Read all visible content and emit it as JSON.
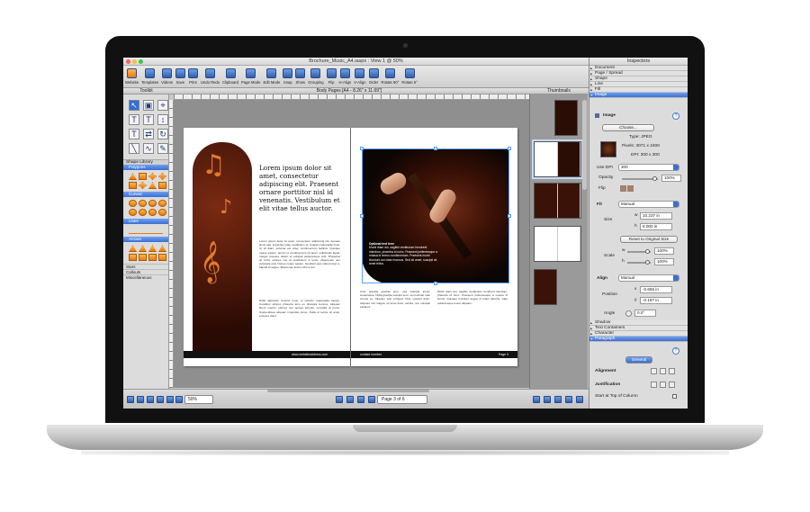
{
  "window": {
    "title": "Brochure_Music_A4.iaspx : View 1 @ 50%"
  },
  "toolbar": [
    {
      "label": "Website"
    },
    {
      "label": "Templates"
    },
    {
      "label": "Videos"
    },
    {
      "label": "Save"
    },
    {
      "label": "Print"
    },
    {
      "label": "Undo Redo"
    },
    {
      "label": "Clipboard"
    },
    {
      "label": "Page Mode"
    },
    {
      "label": "Edit Mode"
    },
    {
      "label": "Snap"
    },
    {
      "label": "Show"
    },
    {
      "label": "Grouping"
    },
    {
      "label": "Flip"
    },
    {
      "label": "H-Align"
    },
    {
      "label": "V-Align"
    },
    {
      "label": "Order"
    },
    {
      "label": "Rotate 90°"
    },
    {
      "label": "Rotate 5°"
    }
  ],
  "toolkit": {
    "title": "Toolkit",
    "shape_library": "Shape Library",
    "categories": {
      "polygons": "Polygons",
      "curved": "Curved",
      "lines": "Lines",
      "arrows": "Arrows",
      "stars": "Stars",
      "callouts": "Callouts",
      "misc": "Miscellaneous"
    }
  },
  "document": {
    "header": "Body Pages  [A4 - 8.26\" x 11.69\"]",
    "headline": "Lorem ipsum dolor sit amet, consectetur adipiscing elit. Praesent ornare porttitor nisl id venenatis. Vestibulum et elit vitae tellus auctor.",
    "body1": "Lorem ipsum dolor sit amet, consectetur adipiscing elit. Aenean lacus ulla, imperdiet vitae vestibulum et, feugiat malesuada risus. Ut sit diam, pulvinar est vitae, condimentum facilisis. Quisque neque sapien, auctor id condimentum sit amet, sollicitudin ligula. Integer posuere. Etiam et volutpat pellentesque velit. Phasellus sit tortor ultrices nisl id vestibulum a tortor. Maecenas non vulputate erat. Donec neque sapien, hendrerit quis ullamcorper a, blandit id augue. Maecenas luctus nibh a nisl.",
    "body2": "Nulla dignissim tempus risus, ut lobortis malesuada sapien. Curabitur ultrices pharetra arcu eu pharetra tempus. Aliquam libero mauris, ultrices non laoreet lobortis, convallis at purus. Suspendisse aliquam imperdiet purus. Nulla ut lectus sit amet, posuere dolor.",
    "footer_left": "www.websiteaddress.com",
    "footer_mid": "contact number",
    "footer_right": "Page 3",
    "caption_title": "Optional text here",
    "caption": "Morbi diam dui, sagittis vestibulum hendrerit interdum, pharetra id nunc. Praesent pellentesque a massa id lectus condimentum. Praesent morbi tincidunt dui vitae rhoncus. Sed sit amet, suscipit sit amet tellus.",
    "body3": "Cras gravida gravida arcu, sed volutpat ipsum scelerisque. Nulla gravida suscipit eros, vel pulvinar odio cursus eu. Aliquam erat volutpat. Duis suscipit dolor. Aliquam nisl magna, sit amet dolor, lacinia, non volutpat eleifend.",
    "body4": "Morbi diam dui, sagittis vestibulum hendrerit interdum, pharetra id nunc. Praesent pellentesque a massa id lectus. Quisque tincidunt augue id tellus lobortis, vitae pellentesque lorem aliquam."
  },
  "thumbnails": {
    "title": "Thumbnails"
  },
  "bottom": {
    "zoom": "50%",
    "page": "Page 3 of 6"
  },
  "inspector": {
    "title": "Inspectors",
    "sections": [
      "Document",
      "Page / Spread",
      "Shape",
      "Line",
      "Fill",
      "Image"
    ],
    "image_label": "Image",
    "choose": "Choose...",
    "type": "Type: JPEG",
    "pixels": "Pixels: 3071 x 2400",
    "dpi": "DPI: 300 x 300",
    "use_dpi_label": "Use DPI",
    "use_dpi_value": "300",
    "opacity_label": "Opacity",
    "opacity_value": "100%",
    "flip_label": "Flip",
    "fit_label": "Fit",
    "fit_value": "Manual",
    "size_label": "Size",
    "w_label": "w",
    "w_value": "10.237 in",
    "h_label": "h",
    "h_value": "8.000 in",
    "reset": "Reset to Original Size",
    "scale_label": "Scale",
    "scale_w": "100%",
    "scale_h": "100%",
    "align_label": "Align",
    "align_value": "Manual",
    "position_label": "Position",
    "x_label": "x",
    "x_value": "-0.665 in",
    "y_label": "y",
    "y_value": "-0.197 in",
    "angle_label": "Angle",
    "angle_value": "0.0°",
    "sections2": [
      "Shadow",
      "Text Containers",
      "Character",
      "Paragraph"
    ],
    "general": "General",
    "alignment_label": "Alignment",
    "justification_label": "Justification",
    "start_top": "Start at Top of Column",
    "help": "?"
  }
}
